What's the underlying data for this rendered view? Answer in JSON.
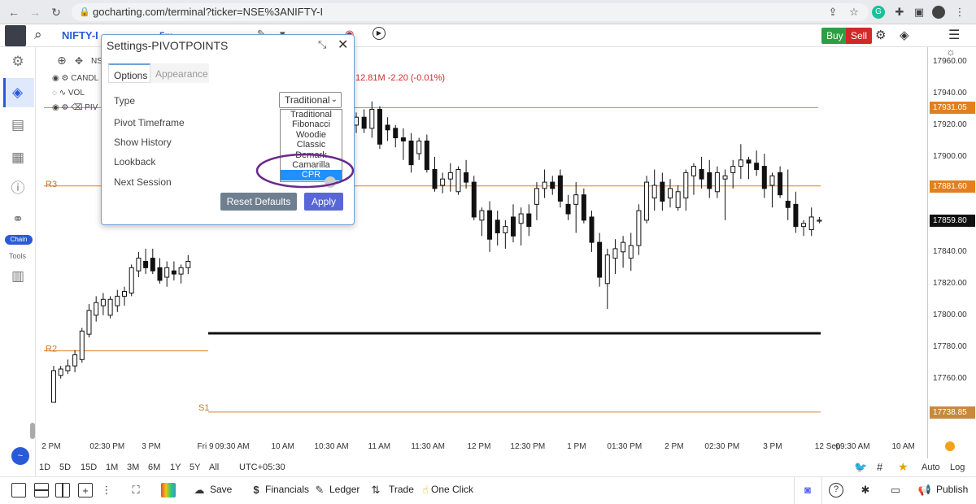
{
  "browser": {
    "url": "gocharting.com/terminal?ticker=NSE%3ANIFTY-I"
  },
  "app": {
    "ticker": "NIFTY-I",
    "interval_label": "5m",
    "buy_label": "Buy",
    "sell_label": "Sell",
    "colors": {
      "buy": "#2e9e44",
      "sell": "#d12828",
      "accent": "#2a5bd7"
    }
  },
  "left_toolbar": {
    "chain_label": "Chain",
    "tools_label": "Tools"
  },
  "legend": {
    "rows": [
      "CANDL",
      "VOL",
      "PIV"
    ],
    "symbol_short": "NS",
    "change_text": "12.81M  -2.20  (-0.01%)"
  },
  "dialog": {
    "title": "Settings-PIVOTPOINTS",
    "tabs": [
      "Options",
      "Appearance"
    ],
    "fields": [
      "Type",
      "Pivot Timeframe",
      "Show History",
      "Lookback",
      "Next Session"
    ],
    "type_value": "Traditional",
    "type_options": [
      "Traditional",
      "Fibonacci",
      "Woodie",
      "Classic",
      "Demark",
      "Camarilla",
      "CPR"
    ],
    "selected_option": "CPR",
    "reset_label": "Reset Defaults",
    "apply_label": "Apply"
  },
  "chart_data": {
    "type": "candlestick",
    "title": "",
    "xlabel": "",
    "ylabel": "",
    "ylim": [
      17730,
      17975
    ],
    "grid": false,
    "x_ticks": [
      "2 PM",
      "02:30 PM",
      "3 PM",
      "Fri 9",
      "09:30 AM",
      "10 AM",
      "10:30 AM",
      "11 AM",
      "11:30 AM",
      "12 PM",
      "12:30 PM",
      "1 PM",
      "01:30 PM",
      "2 PM",
      "02:30 PM",
      "3 PM",
      "12 Sep",
      "09:30 AM",
      "10 AM"
    ],
    "y_ticks": [
      "17960.00",
      "17940.00",
      "17920.00",
      "17900.00",
      "17880.00",
      "17860.00",
      "17840.00",
      "17820.00",
      "17800.00",
      "17780.00",
      "17760.00"
    ],
    "price_tags": [
      {
        "label": "17931.05",
        "value": 17931.05,
        "color": "#e2801f"
      },
      {
        "label": "17881.60",
        "value": 17881.6,
        "color": "#e2801f"
      },
      {
        "label": "17859.80",
        "value": 17859.8,
        "color": "#111111"
      },
      {
        "label": "17738.85",
        "value": 17738.85,
        "color": "#c8893a"
      }
    ],
    "pivot_levels": [
      {
        "label": "R3",
        "value": 17881.6
      },
      {
        "label": "R2",
        "value": 17777.5
      },
      {
        "label": "S1",
        "value": 17738.85
      }
    ],
    "pivot_line": {
      "value": 17788.6
    },
    "candles_prev": [
      [
        17745,
        17768,
        17745,
        17765
      ],
      [
        17762,
        17768,
        17760,
        17766
      ],
      [
        17765,
        17772,
        17763,
        17768
      ],
      [
        17768,
        17778,
        17764,
        17775
      ],
      [
        17772,
        17792,
        17770,
        17790
      ],
      [
        17788,
        17807,
        17786,
        17803
      ],
      [
        17800,
        17812,
        17796,
        17808
      ],
      [
        17806,
        17814,
        17800,
        17810
      ],
      [
        17800,
        17812,
        17798,
        17810
      ],
      [
        17806,
        17816,
        17802,
        17812
      ],
      [
        17812,
        17818,
        17806,
        17815
      ],
      [
        17814,
        17832,
        17812,
        17830
      ],
      [
        17828,
        17840,
        17824,
        17836
      ],
      [
        17834,
        17842,
        17826,
        17830
      ],
      [
        17836,
        17842,
        17826,
        17828
      ],
      [
        17830,
        17836,
        17820,
        17822
      ],
      [
        17824,
        17834,
        17818,
        17830
      ],
      [
        17828,
        17834,
        17822,
        17826
      ],
      [
        17826,
        17832,
        17820,
        17830
      ],
      [
        17830,
        17838,
        17826,
        17834
      ]
    ],
    "candles": [
      [
        17920,
        17928,
        17915,
        17925
      ],
      [
        17925,
        17930,
        17915,
        17918
      ],
      [
        17918,
        17935,
        17912,
        17930
      ],
      [
        17930,
        17932,
        17905,
        17908
      ],
      [
        17920,
        17925,
        17910,
        17917
      ],
      [
        17918,
        17920,
        17906,
        17912
      ],
      [
        17912,
        17918,
        17898,
        17910
      ],
      [
        17910,
        17915,
        17890,
        17895
      ],
      [
        17902,
        17912,
        17898,
        17910
      ],
      [
        17910,
        17914,
        17890,
        17892
      ],
      [
        17892,
        17900,
        17878,
        17880
      ],
      [
        17882,
        17890,
        17877,
        17886
      ],
      [
        17886,
        17896,
        17878,
        17890
      ],
      [
        17878,
        17894,
        17876,
        17892
      ],
      [
        17890,
        17898,
        17880,
        17884
      ],
      [
        17884,
        17888,
        17860,
        17862
      ],
      [
        17860,
        17868,
        17850,
        17866
      ],
      [
        17866,
        17872,
        17840,
        17848
      ],
      [
        17860,
        17866,
        17844,
        17852
      ],
      [
        17852,
        17860,
        17842,
        17856
      ],
      [
        17862,
        17870,
        17846,
        17850
      ],
      [
        17858,
        17868,
        17844,
        17864
      ],
      [
        17864,
        17870,
        17850,
        17856
      ],
      [
        17870,
        17884,
        17860,
        17880
      ],
      [
        17880,
        17892,
        17874,
        17884
      ],
      [
        17884,
        17888,
        17876,
        17880
      ],
      [
        17888,
        17892,
        17868,
        17872
      ],
      [
        17870,
        17876,
        17860,
        17864
      ],
      [
        17870,
        17884,
        17852,
        17876
      ],
      [
        17876,
        17880,
        17858,
        17860
      ],
      [
        17862,
        17866,
        17840,
        17846
      ],
      [
        17846,
        17852,
        17818,
        17824
      ],
      [
        17820,
        17842,
        17804,
        17838
      ],
      [
        17836,
        17848,
        17826,
        17842
      ],
      [
        17840,
        17850,
        17830,
        17846
      ],
      [
        17836,
        17852,
        17828,
        17844
      ],
      [
        17844,
        17870,
        17838,
        17866
      ],
      [
        17860,
        17888,
        17858,
        17884
      ],
      [
        17874,
        17892,
        17866,
        17882
      ],
      [
        17884,
        17890,
        17866,
        17872
      ],
      [
        17874,
        17886,
        17868,
        17880
      ],
      [
        17868,
        17882,
        17866,
        17878
      ],
      [
        17874,
        17892,
        17866,
        17890
      ],
      [
        17888,
        17896,
        17876,
        17894
      ],
      [
        17892,
        17900,
        17880,
        17886
      ],
      [
        17890,
        17898,
        17874,
        17880
      ],
      [
        17878,
        17894,
        17874,
        17890
      ],
      [
        17886,
        17892,
        17860,
        17888
      ],
      [
        17890,
        17898,
        17880,
        17894
      ],
      [
        17894,
        17908,
        17886,
        17898
      ],
      [
        17898,
        17900,
        17886,
        17896
      ],
      [
        17896,
        17904,
        17888,
        17892
      ],
      [
        17894,
        17902,
        17874,
        17880
      ],
      [
        17882,
        17890,
        17868,
        17888
      ],
      [
        17890,
        17894,
        17874,
        17876
      ],
      [
        17872,
        17892,
        17860,
        17868
      ],
      [
        17870,
        17878,
        17852,
        17856
      ],
      [
        17856,
        17860,
        17850,
        17858
      ],
      [
        17854,
        17868,
        17850,
        17862
      ],
      [
        17860,
        17862,
        17858,
        17860
      ]
    ]
  },
  "time_range": {
    "buttons": [
      "1D",
      "5D",
      "15D",
      "1M",
      "3M",
      "6M",
      "1Y",
      "5Y",
      "All"
    ],
    "timezone": "UTC+05:30",
    "auto_label": "Auto",
    "log_label": "Log"
  },
  "bottom_bar": {
    "save_label": "Save",
    "financials_label": "Financials",
    "ledger_label": "Ledger",
    "trade_label": "Trade",
    "one_click_label": "One Click",
    "publish_label": "Publish"
  }
}
